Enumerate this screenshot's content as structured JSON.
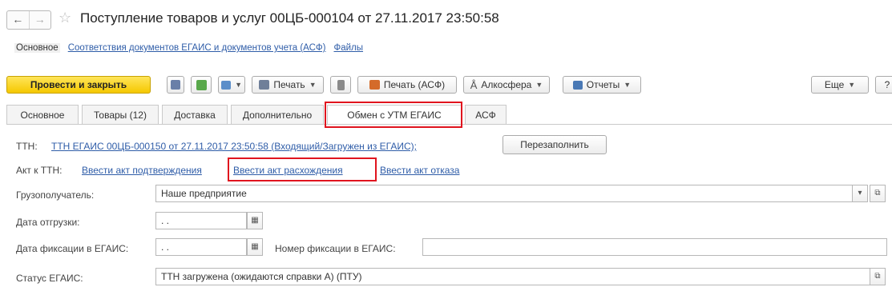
{
  "window": {
    "title": "Поступление товаров и услуг 00ЦБ-000104 от 27.11.2017 23:50:58",
    "nav_back": "←",
    "nav_forward": "→",
    "favorite_icon": "star-icon"
  },
  "sections": {
    "items": [
      "Основное",
      "Соответствия документов ЕГАИС и документов учета (АСФ)",
      "Файлы"
    ]
  },
  "toolbar": {
    "post_close_label": "Провести и закрыть",
    "print_label": "Печать",
    "print_asf_label": "Печать (АСФ)",
    "alcosphere_label": "Алкосфера",
    "reports_label": "Отчеты",
    "more_label": "Еще",
    "help_label": "?"
  },
  "tabs": {
    "items": [
      "Основное",
      "Товары (12)",
      "Доставка",
      "Дополнительно",
      "Обмен с УТМ ЕГАИС",
      "АСФ"
    ],
    "active": "Обмен с УТМ ЕГАИС"
  },
  "form": {
    "ttn_label": "ТТН:",
    "ttn_link": "ТТН ЕГАИС 00ЦБ-000150 от 27.11.2017 23:50:58 (Входящий/Загружен из ЕГАИС);",
    "refill_button": "Перезаполнить",
    "act_label": "Акт к ТТН:",
    "act_confirm": "Ввести акт подтверждения",
    "act_discrepancy": "Ввести акт расхождения",
    "act_refuse": "Ввести акт отказа",
    "consignee_label": "Грузополучатель:",
    "consignee_value": "Наше предприятие",
    "ship_date_label": "Дата отгрузки:",
    "ship_date_value": " .  .",
    "fix_date_label": "Дата фиксации в ЕГАИС:",
    "fix_date_value": " .  .",
    "fix_number_label": "Номер фиксации в ЕГАИС:",
    "fix_number_value": "",
    "status_label": "Статус ЕГАИС:",
    "status_value": "ТТН загружена (ожидаются справки А) (ПТУ)"
  },
  "colors": {
    "highlight": "#e0141e",
    "primary_button": "#f5c800",
    "link": "#2f5da8"
  }
}
